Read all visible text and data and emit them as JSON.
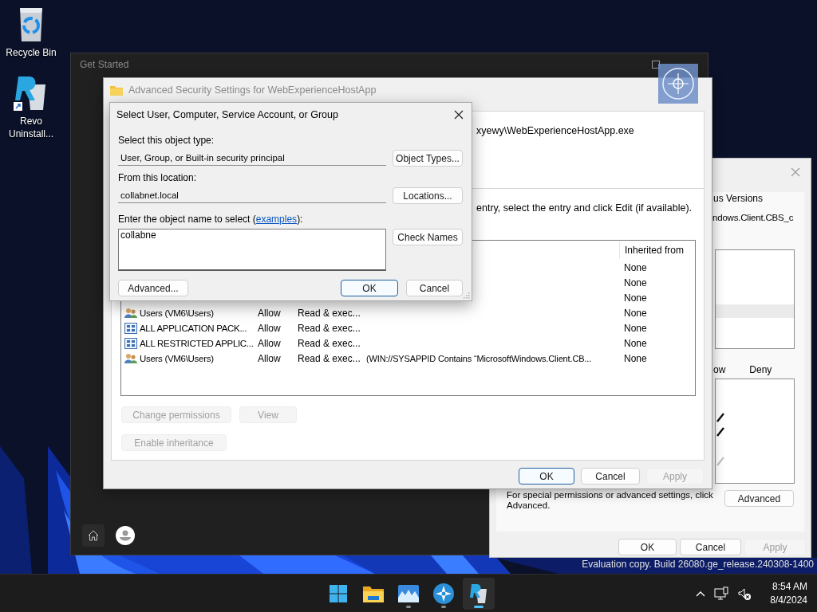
{
  "desktop_icons": [
    {
      "kind": "recycle-bin",
      "label": "Recycle Bin"
    },
    {
      "kind": "revo",
      "label": "Revo Uninstall..."
    }
  ],
  "get_started": {
    "title": "Get Started"
  },
  "properties_dialog": {
    "tab_label": "us Versions",
    "path": "ndows.Client.CBS_c",
    "permission_headers": [
      "ow",
      "Deny"
    ],
    "allow_ticks": [
      {
        "disabled": false
      },
      {
        "disabled": false
      },
      {
        "disabled": true
      }
    ],
    "advanced_note": "For special permissions or advanced settings, click Advanced.",
    "advanced_button": "Advanced",
    "buttons": [
      {
        "label": "OK",
        "default": false,
        "disabled": false
      },
      {
        "label": "Cancel",
        "default": false,
        "disabled": false
      },
      {
        "label": "Apply",
        "default": false,
        "disabled": true
      }
    ]
  },
  "evaluation_notice": "Evaluation copy. Build 26080.ge_release.240308-1400",
  "advanced_window": {
    "title": "Advanced Security Settings for WebExperienceHostApp",
    "name_path": "xyewy\\WebExperienceHostApp.exe",
    "instructions": "entry, select the entry and click Edit (if available).",
    "inherited_header": "Inherited from",
    "rows": [
      {
        "inherited_from": "None"
      },
      {
        "inherited_from": "None"
      },
      {
        "inherited_from": "None"
      },
      {
        "kind": "users",
        "principal": "Users (VM6\\Users)",
        "type": "Allow",
        "access": "Read & exec...",
        "inherited_from": "None"
      },
      {
        "kind": "package",
        "principal": "ALL APPLICATION PACK...",
        "type": "Allow",
        "access": "Read & exec...",
        "inherited_from": "None"
      },
      {
        "kind": "package",
        "principal": "ALL RESTRICTED APPLIC...",
        "type": "Allow",
        "access": "Read & exec...",
        "inherited_from": "None"
      },
      {
        "kind": "users",
        "principal": "Users (VM6\\Users)",
        "type": "Allow",
        "access": "Read & exec...",
        "condition": "(WIN://SYSAPPID Contains “MicrosoftWindows.Client.CB...",
        "inherited_from": "None"
      }
    ],
    "actions": [
      {
        "label": "Change permissions",
        "disabled": true
      },
      {
        "label": "View",
        "disabled": true
      },
      {
        "label": "Enable inheritance",
        "disabled": true
      }
    ],
    "buttons": [
      {
        "label": "OK",
        "default": true,
        "disabled": false
      },
      {
        "label": "Cancel",
        "default": false,
        "disabled": false
      },
      {
        "label": "Apply",
        "default": false,
        "disabled": true
      }
    ]
  },
  "select_dialog": {
    "title": "Select User, Computer, Service Account, or Group",
    "object_type_label": "Select this object type:",
    "object_type": "User, Group, or Built-in security principal",
    "object_types_button": "Object Types...",
    "location_label": "From this location:",
    "location": "collabnet.local",
    "locations_button": "Locations...",
    "name_label": {
      "before": "Enter the object name to select (",
      "link": "examples",
      "after": "):"
    },
    "name_value": "collabne",
    "check_names_button": "Check Names",
    "buttons": [
      {
        "label": "Advanced...",
        "default": false
      },
      {
        "label": "OK",
        "default": true
      },
      {
        "label": "Cancel",
        "default": false
      }
    ]
  },
  "taskbar": {
    "items": [
      {
        "kind": "start",
        "running": false,
        "selected": false
      },
      {
        "kind": "folder",
        "running": false,
        "selected": false
      },
      {
        "kind": "photos",
        "running": true,
        "selected": false
      },
      {
        "kind": "compass",
        "running": true,
        "selected": false
      },
      {
        "kind": "revo",
        "running": true,
        "selected": true
      }
    ],
    "time": "8:54 AM",
    "date": "8/4/2024"
  }
}
